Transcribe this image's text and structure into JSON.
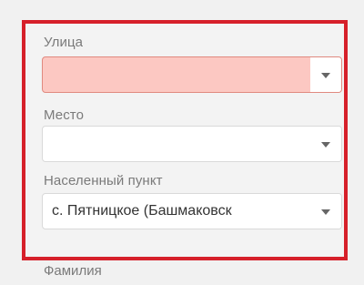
{
  "form": {
    "fields": [
      {
        "label": "Улица",
        "value": "",
        "state": "invalid"
      },
      {
        "label": "Место",
        "value": "",
        "state": "normal"
      },
      {
        "label": "Населенный пункт",
        "value": "с. Пятницкое (Башмаковск",
        "state": "normal"
      }
    ],
    "next_field_label": "Фамилия"
  },
  "colors": {
    "highlight_border": "#d6202a",
    "invalid_fill": "#fcc8c2",
    "label_text": "#7a7a7a"
  },
  "icons": {
    "dropdown": "chevron-down-icon"
  }
}
